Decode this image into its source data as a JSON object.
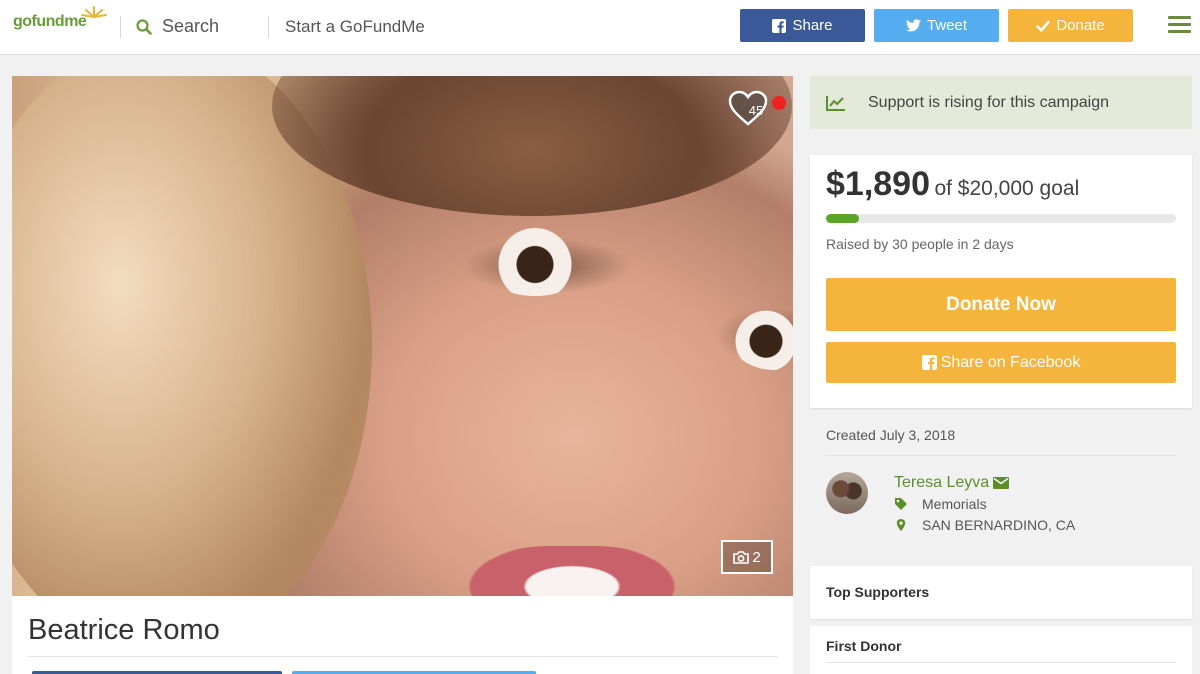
{
  "header": {
    "logo": "gofundme",
    "search_label": "Search",
    "start_label": "Start a GoFundMe",
    "share_label": "Share",
    "tweet_label": "Tweet",
    "donate_label": "Donate"
  },
  "campaign": {
    "heart_count": "45",
    "photo_count": "2",
    "title": "Beatrice Romo"
  },
  "sidebar": {
    "rising_text": "Support is rising for this campaign",
    "amount_raised": "$1,890",
    "goal_text": "of $20,000 goal",
    "progress_fraction": 0.0945,
    "raised_by": "Raised by 30 people in 2 days",
    "donate_now_label": "Donate Now",
    "share_facebook_label": "Share on Facebook",
    "created": "Created July 3, 2018",
    "organizer": "Teresa Leyva",
    "category": "Memorials",
    "location": "SAN BERNARDINO, CA",
    "top_supporters": "Top Supporters",
    "first_donor": "First Donor"
  },
  "colors": {
    "brand_green": "#5ca424",
    "facebook_blue": "#3b5998",
    "twitter_blue": "#55acee",
    "donate_orange": "#f5b53c"
  },
  "icons": [
    "search-icon",
    "facebook-icon",
    "twitter-icon",
    "check-icon",
    "hamburger-menu-icon",
    "heart-icon",
    "camera-icon",
    "trend-up-icon",
    "envelope-icon",
    "tag-icon",
    "map-marker-icon"
  ]
}
